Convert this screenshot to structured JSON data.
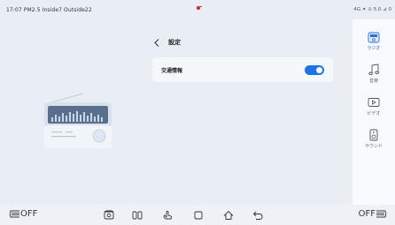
{
  "status_bar": {
    "left_text": "17:07 PM2.5 Inside7 Outside22",
    "right_text": "4G ✦ ⊙ 5.0 ⊿ 0"
  },
  "settings": {
    "title": "設定",
    "traffic_info_label": "交通情報",
    "traffic_info_enabled": true
  },
  "sidebar": {
    "items": [
      {
        "label": "ラジオ",
        "icon": "radio-icon",
        "active": true
      },
      {
        "label": "音楽",
        "icon": "music-note-icon",
        "active": false
      },
      {
        "label": "ビデオ",
        "icon": "video-icon",
        "active": false
      },
      {
        "label": "サウンド",
        "icon": "speaker-icon",
        "active": false
      }
    ]
  },
  "bottom_bar": {
    "left_label": "OFF",
    "right_label": "OFF",
    "nav_icons": [
      "camera-icon",
      "split-screen-icon",
      "touch-icon",
      "square-icon",
      "home-icon",
      "back-arrow-icon"
    ]
  },
  "colors": {
    "accent": "#1f73e8",
    "background": "#e9eef4",
    "card": "#f5f8fb"
  }
}
